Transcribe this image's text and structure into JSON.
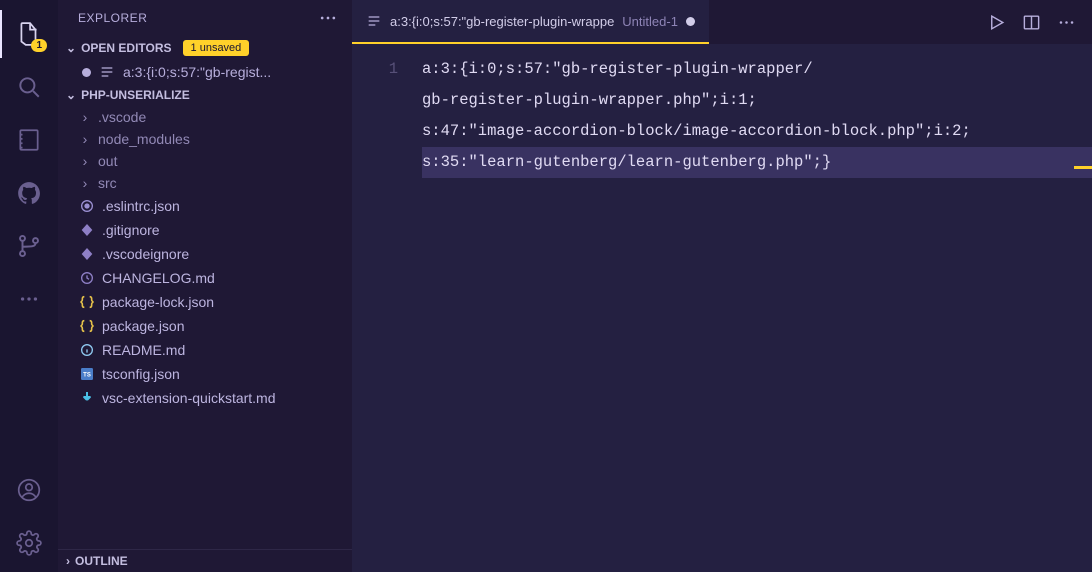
{
  "activityBar": {
    "explorerBadge": "1"
  },
  "sidebar": {
    "title": "EXPLORER",
    "openEditorsLabel": "OPEN EDITORS",
    "unsavedLabel": "1 unsaved",
    "openEditors": [
      {
        "name": "a:3:{i:0;s:57:\"gb-regist...",
        "iconType": "list"
      }
    ],
    "workspaceLabel": "PHP-UNSERIALIZE",
    "tree": [
      {
        "kind": "folder",
        "name": ".vscode"
      },
      {
        "kind": "folder",
        "name": "node_modules"
      },
      {
        "kind": "folder",
        "name": "out"
      },
      {
        "kind": "folder",
        "name": "src"
      },
      {
        "kind": "file",
        "name": ".eslintrc.json",
        "icon": "target",
        "color": "#9a8fd1"
      },
      {
        "kind": "file",
        "name": ".gitignore",
        "icon": "diamond",
        "color": "#8e7fc6"
      },
      {
        "kind": "file",
        "name": ".vscodeignore",
        "icon": "diamond",
        "color": "#8e7fc6"
      },
      {
        "kind": "file",
        "name": "CHANGELOG.md",
        "icon": "clock",
        "color": "#8e7fc6"
      },
      {
        "kind": "file",
        "name": "package-lock.json",
        "icon": "braces",
        "color": "#e6c24a"
      },
      {
        "kind": "file",
        "name": "package.json",
        "icon": "braces",
        "color": "#e6c24a"
      },
      {
        "kind": "file",
        "name": "README.md",
        "icon": "info",
        "color": "#8fc9f0"
      },
      {
        "kind": "file",
        "name": "tsconfig.json",
        "icon": "ts",
        "color": "#4a7dc9"
      },
      {
        "kind": "file",
        "name": "vsc-extension-quickstart.md",
        "icon": "arrow-down",
        "color": "#4abfe6"
      }
    ],
    "outlineLabel": "OUTLINE"
  },
  "tabs": {
    "activeTitle1": "a:3:{i:0;s:57:\"gb-register-plugin-wrappe",
    "activeTitle2": "Untitled-1"
  },
  "editor": {
    "lineNumbers": [
      "1"
    ],
    "lines": [
      "a:3:{i:0;s:57:\"gb-register-plugin-wrapper/",
      "gb-register-plugin-wrapper.php\";i:1;",
      "s:47:\"image-accordion-block/image-accordion-block.php\";i:2;",
      "s:35:\"learn-gutenberg/learn-gutenberg.php\";}"
    ],
    "selectedLineIndex": 3
  }
}
